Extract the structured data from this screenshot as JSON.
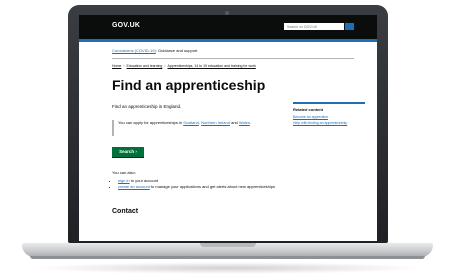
{
  "header": {
    "logo_text": "GOV.UK",
    "search_placeholder": "Search on GOV.UK"
  },
  "phase_banner": {
    "link": "Coronavirus (COVID-19)",
    "text": ": Guidance and support"
  },
  "breadcrumbs": [
    "Home",
    "Education and learning",
    "Apprenticeships, 14 to 19 education and training for work"
  ],
  "page": {
    "title": "Find an apprenticeship",
    "lede": "Find an apprenticeship in England.",
    "inset_text": "You can apply for apprenticeships in",
    "inset_links": [
      "Scotland",
      "Northern Ireland",
      "Wales"
    ],
    "inset_conj": "and",
    "start_button": "Search ›",
    "also_label": "You can also:",
    "also_items": [
      {
        "link": "sign in",
        "text": "to your account"
      },
      {
        "link": "create an account",
        "text": "to manage your applications and get alerts about new apprenticeships"
      }
    ],
    "contact_heading": "Contact"
  },
  "related": {
    "title": "Related content",
    "links": [
      "Become an apprentice",
      "Help with finding an apprenticeship"
    ]
  },
  "colors": {
    "header_bg": "#0b0c0c",
    "brand_blue": "#1d70b8",
    "button_green": "#00703c",
    "link": "#1d70b8"
  }
}
